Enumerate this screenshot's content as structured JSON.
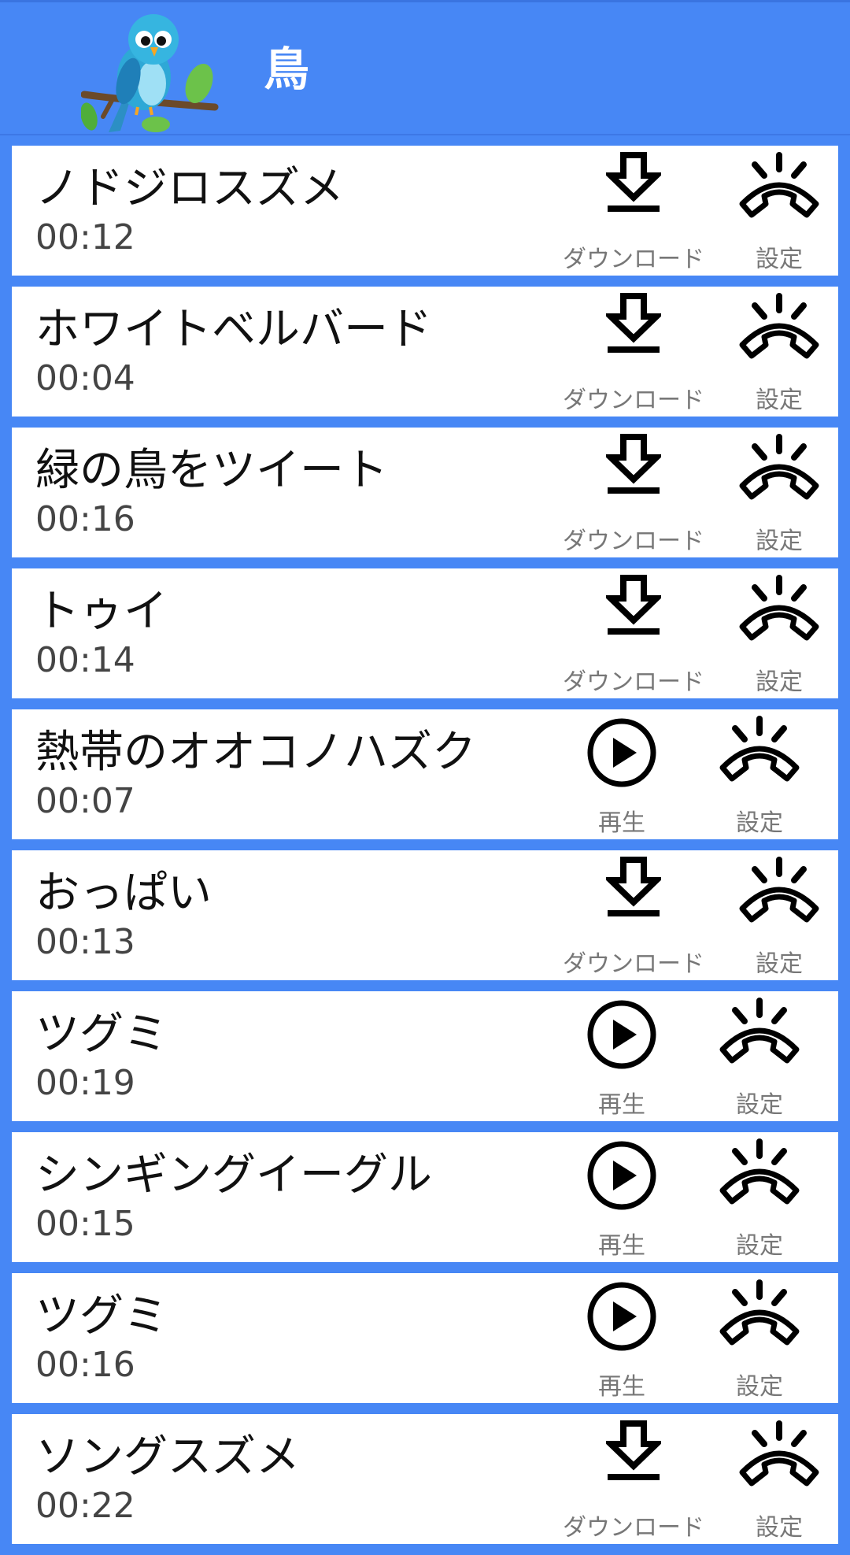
{
  "app": {
    "title": "鳥"
  },
  "labels": {
    "download": "ダウンロード",
    "play": "再生",
    "settings": "設定"
  },
  "items": [
    {
      "name": "ノドジロスズメ",
      "duration": "00:12",
      "action": "download"
    },
    {
      "name": "ホワイトベルバード",
      "duration": "00:04",
      "action": "download"
    },
    {
      "name": "緑の鳥をツイート",
      "duration": "00:16",
      "action": "download"
    },
    {
      "name": "トゥイ",
      "duration": "00:14",
      "action": "download"
    },
    {
      "name": "熱帯のオオコノハズク",
      "duration": "00:07",
      "action": "play"
    },
    {
      "name": "おっぱい",
      "duration": "00:13",
      "action": "download"
    },
    {
      "name": "ツグミ",
      "duration": "00:19",
      "action": "play"
    },
    {
      "name": "シンギングイーグル",
      "duration": "00:15",
      "action": "play"
    },
    {
      "name": "ツグミ",
      "duration": "00:16",
      "action": "play"
    },
    {
      "name": "ソングスズメ",
      "duration": "00:22",
      "action": "download"
    }
  ],
  "icons": {
    "logo": "bird-on-branch-icon",
    "download": "download-arrow-icon",
    "play": "play-circle-icon",
    "settings": "ringing-phone-icon"
  },
  "colors": {
    "header_bg": "#4787f5",
    "card_bg": "#ffffff",
    "title_text": "#ffffff"
  }
}
